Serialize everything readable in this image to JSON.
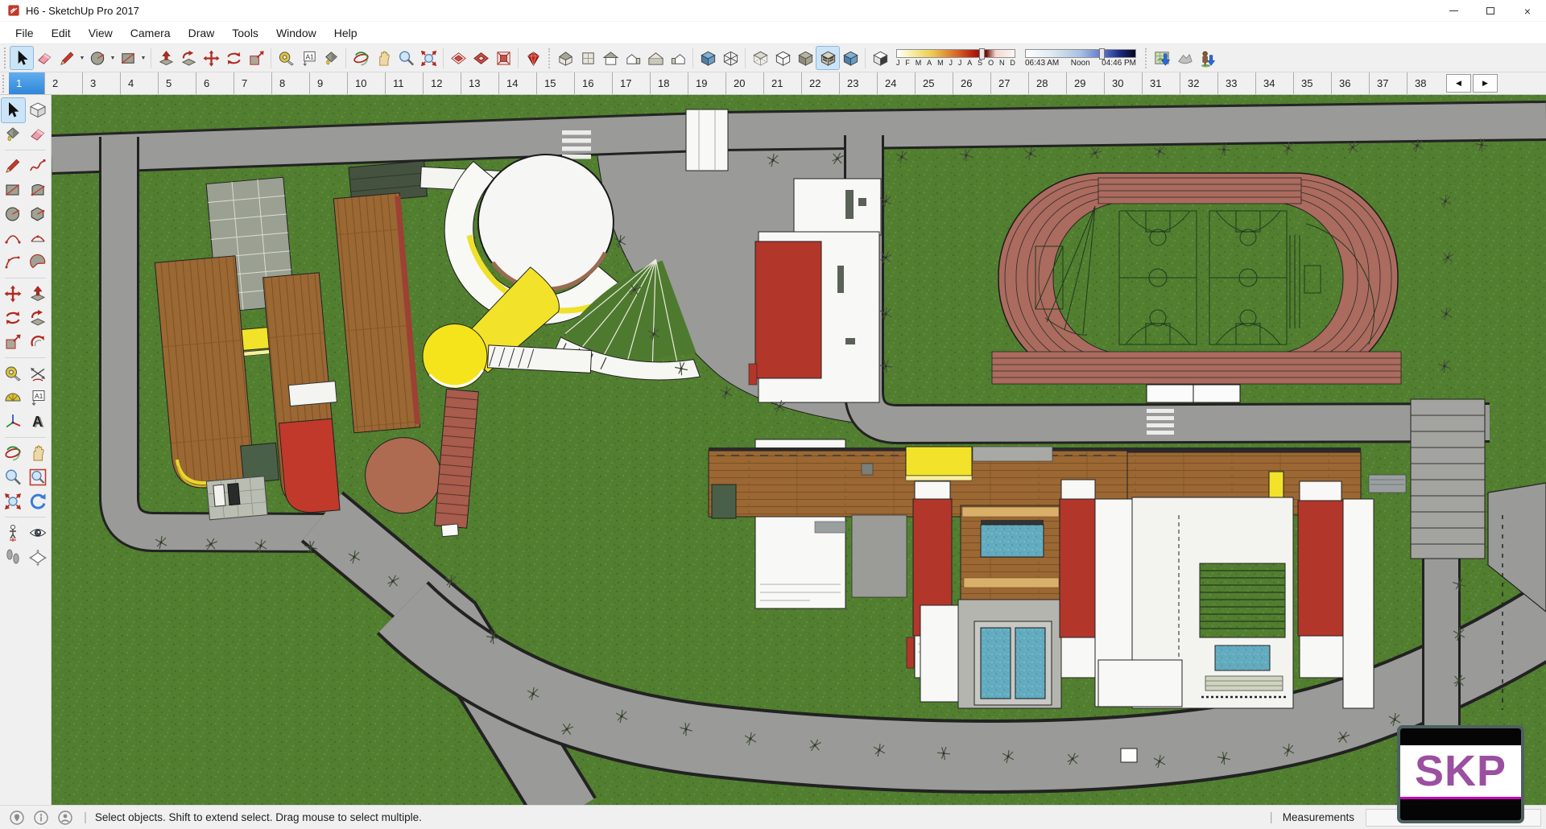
{
  "window": {
    "title": "H6 - SketchUp Pro 2017",
    "controls": [
      "minimize",
      "maximize",
      "close"
    ]
  },
  "menu": {
    "items": [
      "File",
      "Edit",
      "View",
      "Camera",
      "Draw",
      "Tools",
      "Window",
      "Help"
    ]
  },
  "toolbar": {
    "active_tool": "select",
    "active_face_style": "shaded-with-textures",
    "tools": [
      "select",
      "eraser",
      "line",
      "arc",
      "rectangle",
      "push-pull",
      "follow-me",
      "move",
      "rotate",
      "scale",
      "tape-measure",
      "text",
      "paint-bucket",
      "orbit",
      "pan",
      "zoom",
      "zoom-extents",
      "section-plane",
      "section-display",
      "section-cuts",
      "sketchup-gem",
      "iso-view",
      "top-view",
      "front-view",
      "right-view",
      "back-view",
      "left-view",
      "shaded-box",
      "wireframe",
      "x-ray",
      "hidden-line",
      "shaded",
      "shaded-with-textures",
      "monochrome",
      "shadow-settings",
      "date-slider",
      "time-slider",
      "add-location",
      "toggle-terrain",
      "photo-textures"
    ],
    "shadow": {
      "months": [
        "J",
        "F",
        "M",
        "A",
        "M",
        "J",
        "J",
        "A",
        "S",
        "O",
        "N",
        "D"
      ],
      "time_start": "06:43 AM",
      "time_noon": "Noon",
      "time_end": "04:46 PM"
    }
  },
  "scene_tabs": {
    "active": "1",
    "tabs": [
      "1",
      "2",
      "3",
      "4",
      "5",
      "6",
      "7",
      "8",
      "9",
      "10",
      "11",
      "12",
      "13",
      "14",
      "15",
      "16",
      "17",
      "18",
      "19",
      "20",
      "21",
      "22",
      "23",
      "24",
      "25",
      "26",
      "27",
      "28",
      "29",
      "30",
      "31",
      "32",
      "33",
      "34",
      "35",
      "36",
      "37",
      "38"
    ]
  },
  "palette": {
    "tools": [
      "select",
      "make-component",
      "paint-bucket",
      "eraser",
      "line",
      "freehand",
      "rectangle",
      "rotated-rectangle",
      "circle",
      "polygon",
      "arc",
      "two-point-arc",
      "three-point-arc",
      "pie",
      "move",
      "push-pull",
      "rotate",
      "follow-me",
      "scale",
      "offset",
      "tape-measure",
      "dimension",
      "protractor",
      "text",
      "axes",
      "3d-text",
      "orbit",
      "pan",
      "zoom",
      "zoom-window",
      "zoom-extents",
      "previous",
      "position-camera",
      "look-around",
      "walk",
      "section-plane"
    ]
  },
  "status": {
    "message": "Select objects. Shift to extend select. Drag mouse to select multiple.",
    "measurements_label": "Measurements",
    "measurements_value": ""
  },
  "watermark": {
    "text": "SKP"
  },
  "colors": {
    "accent_blue": "#2f86d8",
    "grass": "#527e30",
    "road": "#9a9a98",
    "track": "#ab6b5e",
    "wood": "#9b6733",
    "building_red": "#b3362b",
    "building_white": "#f8f8f6",
    "pool_blue": "#62aabe",
    "accent_yellow": "#f2e32a",
    "plaza_brown": "#ae6b52"
  }
}
